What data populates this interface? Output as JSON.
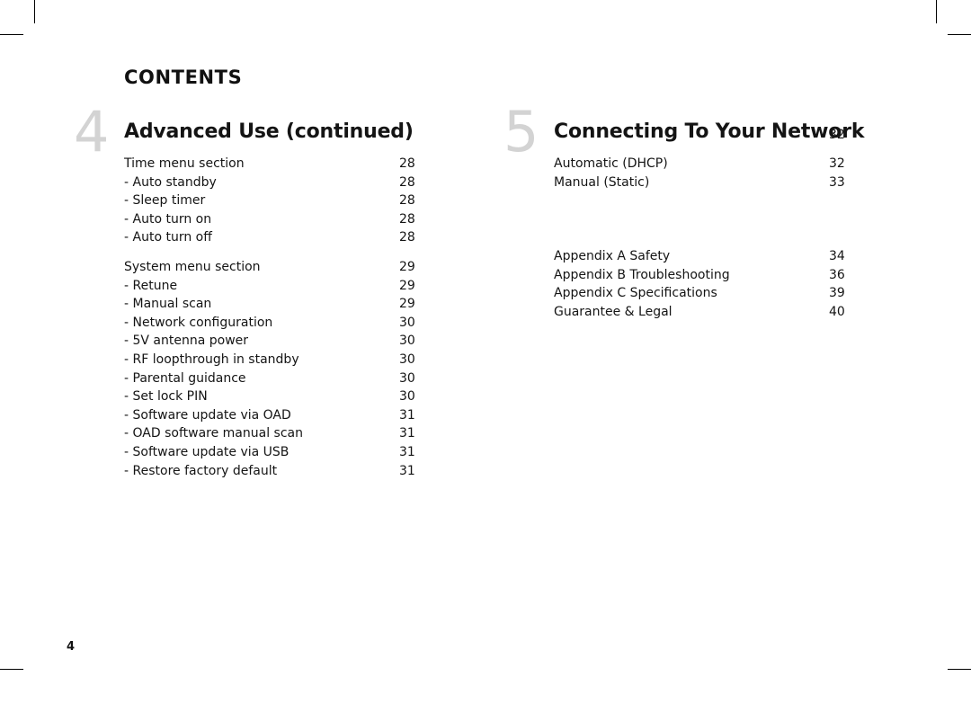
{
  "header": {
    "title": "CONTENTS"
  },
  "folio": "4",
  "columns": {
    "left": {
      "chapter": {
        "number": "4",
        "title": "Advanced Use (continued)",
        "page": ""
      },
      "entries": [
        {
          "label": "Time menu section",
          "page": "28",
          "type": "section"
        },
        {
          "label": "- Auto standby",
          "page": "28",
          "type": "item"
        },
        {
          "label": "- Sleep timer",
          "page": "28",
          "type": "item"
        },
        {
          "label": "- Auto turn on",
          "page": "28",
          "type": "item"
        },
        {
          "label": "- Auto turn off",
          "page": "28",
          "type": "item"
        },
        {
          "label": "",
          "page": "",
          "type": "gap"
        },
        {
          "label": "System menu section",
          "page": "29",
          "type": "section"
        },
        {
          "label": "- Retune",
          "page": "29",
          "type": "item"
        },
        {
          "label": "- Manual scan",
          "page": "29",
          "type": "item"
        },
        {
          "label": "- Network configuration",
          "page": "30",
          "type": "item"
        },
        {
          "label": "- 5V antenna power",
          "page": "30",
          "type": "item"
        },
        {
          "label": "- RF loopthrough in standby",
          "page": "30",
          "type": "item"
        },
        {
          "label": "- Parental guidance",
          "page": "30",
          "type": "item"
        },
        {
          "label": "- Set lock PIN",
          "page": "30",
          "type": "item"
        },
        {
          "label": "- Software update via OAD",
          "page": "31",
          "type": "item"
        },
        {
          "label": "- OAD software manual scan",
          "page": "31",
          "type": "item"
        },
        {
          "label": "- Software update via USB",
          "page": "31",
          "type": "item"
        },
        {
          "label": "- Restore factory default",
          "page": "31",
          "type": "item"
        }
      ]
    },
    "right": {
      "chapter": {
        "number": "5",
        "title": "Connecting To Your Network",
        "page": "32"
      },
      "entries": [
        {
          "label": "Automatic (DHCP)",
          "page": "32",
          "type": "section"
        },
        {
          "label": "Manual (Static)",
          "page": "33",
          "type": "section"
        },
        {
          "label": "",
          "page": "",
          "type": "biggap"
        },
        {
          "label": "Appendix A Safety",
          "page": "34",
          "type": "section"
        },
        {
          "label": "Appendix B Troubleshooting",
          "page": "36",
          "type": "section"
        },
        {
          "label": "Appendix C Specifications",
          "page": "39",
          "type": "section"
        },
        {
          "label": "Guarantee & Legal",
          "page": "40",
          "type": "section"
        }
      ]
    }
  }
}
